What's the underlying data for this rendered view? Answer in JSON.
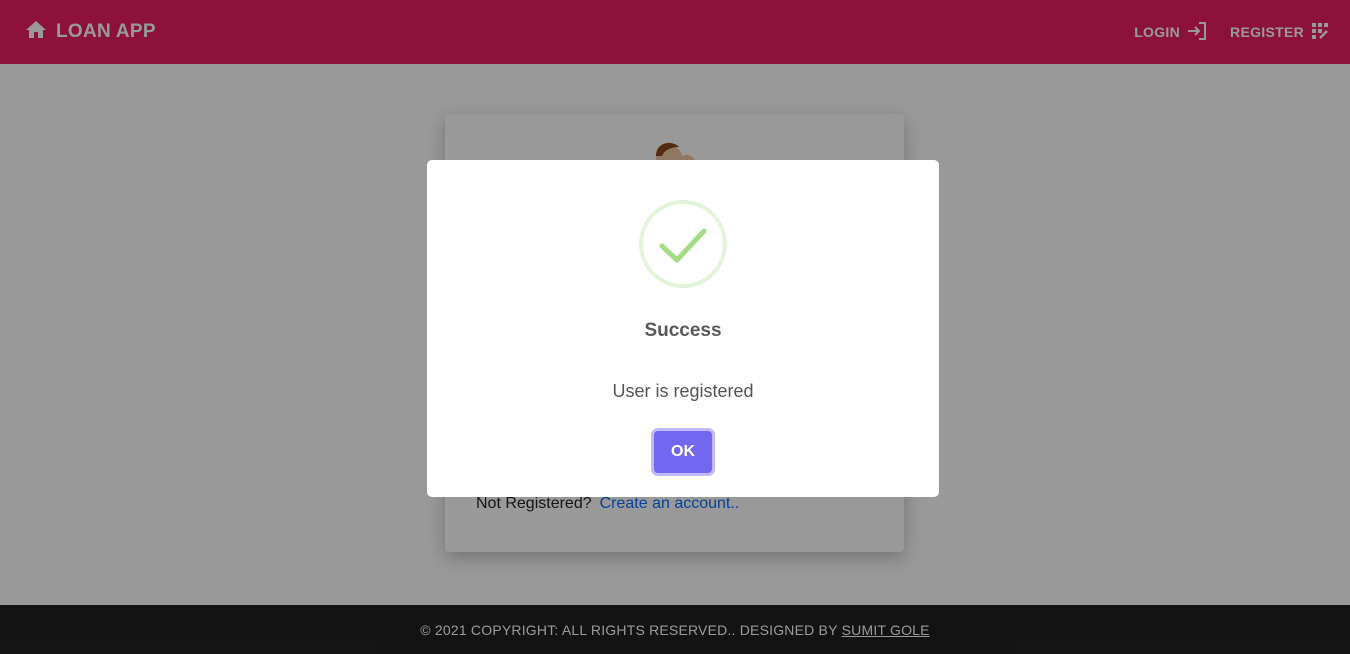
{
  "navbar": {
    "brand_icon": "home-icon",
    "brand_title": "LOAN APP",
    "login_label": "LOGIN",
    "login_icon": "login-icon",
    "register_label": "REGISTER",
    "register_icon": "register-icon",
    "background_color": "#e91e63"
  },
  "login_card": {
    "avatar_icon": "user-avatar-icon",
    "not_registered_text": "Not Registered?",
    "create_account_link": "Create an account.."
  },
  "modal": {
    "icon": "success-check-icon",
    "title": "Success",
    "message": "User is registered",
    "ok_label": "OK",
    "button_color": "#7367f0",
    "check_color": "#a5dc86"
  },
  "footer": {
    "copyright_text": "© 2021 COPYRIGHT: ALL RIGHTS RESERVED.. DESIGNED BY",
    "author_link": "SUMIT GOLE"
  }
}
